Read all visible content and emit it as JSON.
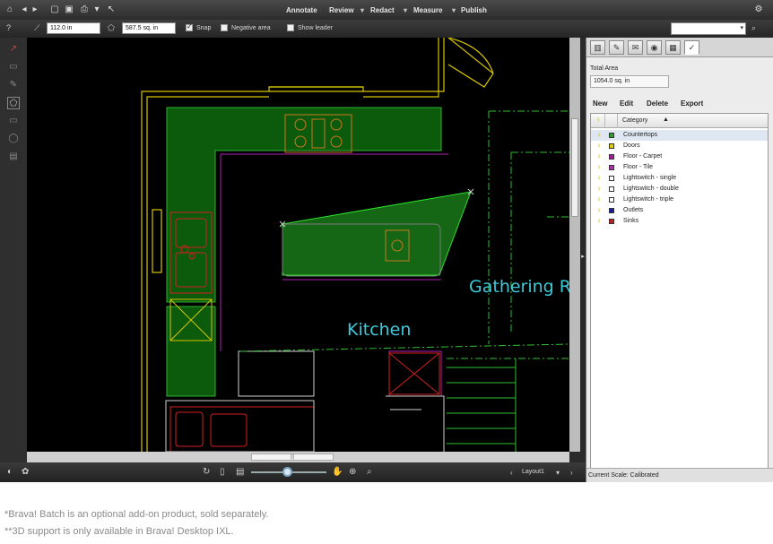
{
  "menubar": {
    "menus": [
      "Annotate",
      "Review",
      "Redact",
      "Measure",
      "Publish"
    ]
  },
  "toolbar2": {
    "length_value": "112.0 in",
    "area_value": "587.5 sq. in",
    "snap_label": "Snap",
    "negative_area_label": "Negative area",
    "show_leader_label": "Show leader",
    "snap_checked": true,
    "negative_area_checked": false,
    "show_leader_checked": false
  },
  "canvas": {
    "room_kitchen": "Kitchen",
    "room_gathering": "Gathering R"
  },
  "bottombar": {
    "layout_label": "Layout1"
  },
  "panel": {
    "total_area_label": "Total Area",
    "total_area_value": "1054.0 sq. in",
    "actions": {
      "new": "New",
      "edit": "Edit",
      "delete": "Delete",
      "export": "Export"
    },
    "table": {
      "header_category": "Category",
      "rows": [
        {
          "name": "Countertops",
          "color": "#2f9e2f",
          "selected": true
        },
        {
          "name": "Doors",
          "color": "#e0d000",
          "selected": false
        },
        {
          "name": "Floor - Carpet",
          "color": "#a020a0",
          "selected": false
        },
        {
          "name": "Floor - Tile",
          "color": "#b030b0",
          "selected": false
        },
        {
          "name": "Lightswitch - single",
          "color": "#ffffff",
          "selected": false
        },
        {
          "name": "Lightswitch - double",
          "color": "#ffffff",
          "selected": false
        },
        {
          "name": "Lightswitch - triple",
          "color": "#ffffff",
          "selected": false
        },
        {
          "name": "Outlets",
          "color": "#1a1aa0",
          "selected": false
        },
        {
          "name": "Sinks",
          "color": "#c02020",
          "selected": false
        }
      ]
    },
    "status": "Current Scale:  Calibrated"
  },
  "footnotes": {
    "line1": "*Brava! Batch is an optional add-on product, sold separately.",
    "line2": "**3D support is only available in Brava! Desktop IXL."
  }
}
